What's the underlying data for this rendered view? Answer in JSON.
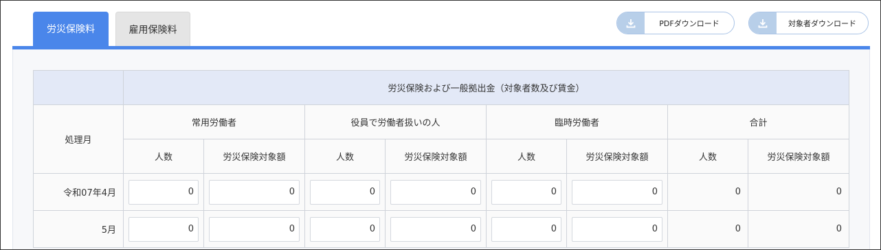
{
  "tabs": [
    {
      "label": "労災保険料"
    },
    {
      "label": "雇用保険料"
    }
  ],
  "buttons": {
    "pdf_download": "PDFダウンロード",
    "target_download": "対象者ダウンロード"
  },
  "table": {
    "group_header": "労災保険および一般拠出金（対象者数及び賃金）",
    "month_header": "処理月",
    "categories": [
      "常用労働者",
      "役員で労働者扱いの人",
      "臨時労働者",
      "合計"
    ],
    "sub_headers": {
      "count": "人数",
      "amount": "労災保険対象額"
    },
    "rows": [
      {
        "month": "令和07年4月",
        "values": [
          "0",
          "0",
          "0",
          "0",
          "0",
          "0"
        ],
        "total_count": "0",
        "total_amount": "0"
      },
      {
        "month": "5月",
        "values": [
          "0",
          "0",
          "0",
          "0",
          "0",
          "0"
        ],
        "total_count": "0",
        "total_amount": "0"
      }
    ]
  },
  "colors": {
    "accent": "#4a86ea",
    "header_bg": "#e3e9f7"
  }
}
